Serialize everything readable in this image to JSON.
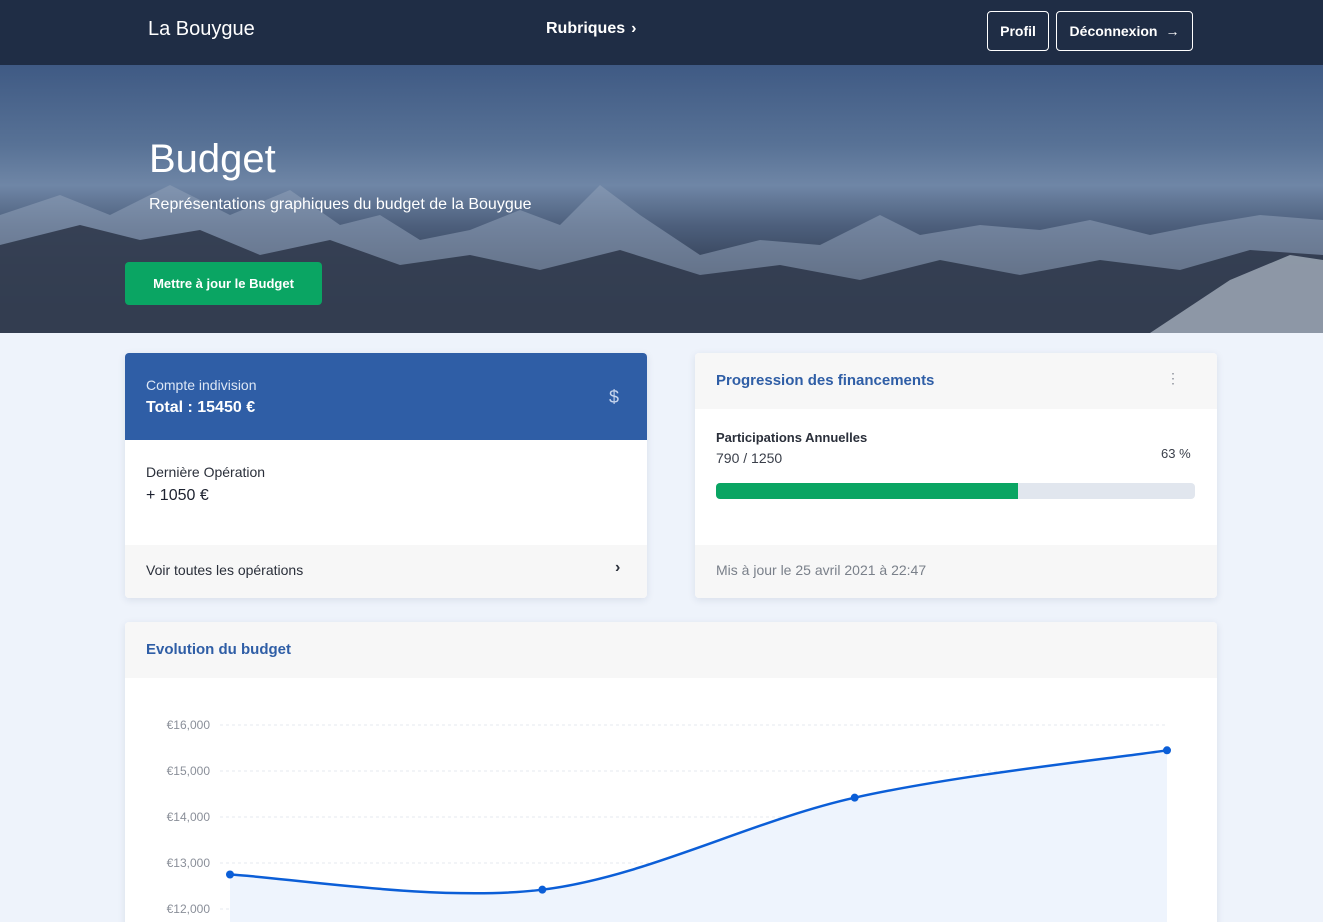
{
  "nav": {
    "brand": "La Bouygue",
    "rubriques": "Rubriques",
    "profil": "Profil",
    "logout": "Déconnexion"
  },
  "hero": {
    "title": "Budget",
    "subtitle": "Représentations graphiques du budget de la Bouygue",
    "button": "Mettre à jour le Budget"
  },
  "account": {
    "label": "Compte indivision",
    "total": "Total : 15450 €",
    "icon": "dollar-icon",
    "last_op_label": "Dernière Opération",
    "last_op_value": "+ 1050 €",
    "footer": "Voir toutes les opérations"
  },
  "progress": {
    "title": "Progression des financements",
    "label": "Participations Annuelles",
    "value_text": "790 / 1250",
    "percent_text": "63 %",
    "fraction": 0.63,
    "updated": "Mis à jour le 25 avril 2021 à 22:47"
  },
  "colors": {
    "navbar": "#1f2d45",
    "accent_green": "#0aa563",
    "card_blue": "#2f5ea6",
    "line_blue": "#0b5ed7"
  },
  "chart_data": {
    "type": "line",
    "title": "Evolution du budget",
    "x": [
      0,
      1,
      2,
      3
    ],
    "series": [
      {
        "values": [
          12750,
          12420,
          14420,
          15450
        ]
      }
    ],
    "yticks": [
      "€16,000",
      "€15,000",
      "€14,000",
      "€13,000",
      "€12,000"
    ],
    "ytick_values": [
      16000,
      15000,
      14000,
      13000,
      12000
    ],
    "ylim": [
      11500,
      16000
    ],
    "grid": true,
    "area_fill": true
  }
}
